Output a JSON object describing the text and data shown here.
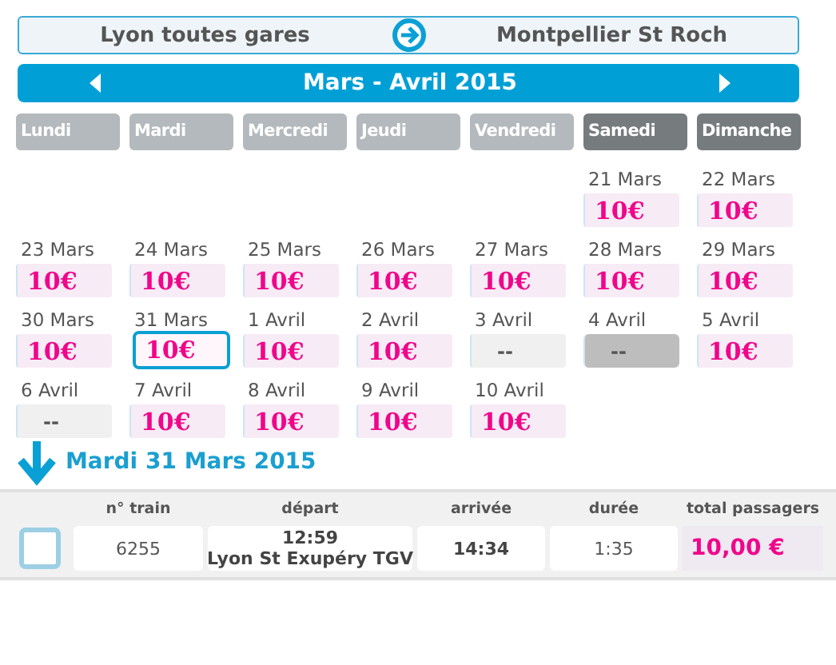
{
  "route": {
    "from": "Lyon toutes gares",
    "to": "Montpellier St Roch"
  },
  "month": {
    "title": "Mars - Avril 2015"
  },
  "weekdays": [
    {
      "label": "Lundi",
      "weekend": false
    },
    {
      "label": "Mardi",
      "weekend": false
    },
    {
      "label": "Mercredi",
      "weekend": false
    },
    {
      "label": "Jeudi",
      "weekend": false
    },
    {
      "label": "Vendredi",
      "weekend": false
    },
    {
      "label": "Samedi",
      "weekend": true
    },
    {
      "label": "Dimanche",
      "weekend": true
    }
  ],
  "weeks": [
    [
      {
        "kind": "empty"
      },
      {
        "kind": "empty"
      },
      {
        "kind": "empty"
      },
      {
        "kind": "empty"
      },
      {
        "kind": "empty"
      },
      {
        "kind": "price",
        "date": "21 Mars",
        "value": "10€",
        "selected": false,
        "hovered": false
      },
      {
        "kind": "price",
        "date": "22 Mars",
        "value": "10€",
        "selected": false,
        "hovered": false
      }
    ],
    [
      {
        "kind": "price",
        "date": "23 Mars",
        "value": "10€",
        "selected": false,
        "hovered": false
      },
      {
        "kind": "price",
        "date": "24 Mars",
        "value": "10€",
        "selected": false,
        "hovered": false
      },
      {
        "kind": "price",
        "date": "25 Mars",
        "value": "10€",
        "selected": false,
        "hovered": false
      },
      {
        "kind": "price",
        "date": "26 Mars",
        "value": "10€",
        "selected": false,
        "hovered": false
      },
      {
        "kind": "price",
        "date": "27 Mars",
        "value": "10€",
        "selected": false,
        "hovered": false
      },
      {
        "kind": "price",
        "date": "28 Mars",
        "value": "10€",
        "selected": false,
        "hovered": false
      },
      {
        "kind": "price",
        "date": "29 Mars",
        "value": "10€",
        "selected": false,
        "hovered": false
      }
    ],
    [
      {
        "kind": "price",
        "date": "30 Mars",
        "value": "10€",
        "selected": false,
        "hovered": false
      },
      {
        "kind": "price",
        "date": "31 Mars",
        "value": "10€",
        "selected": true,
        "hovered": false
      },
      {
        "kind": "price",
        "date": "1 Avril",
        "value": "10€",
        "selected": false,
        "hovered": false
      },
      {
        "kind": "price",
        "date": "2 Avril",
        "value": "10€",
        "selected": false,
        "hovered": false
      },
      {
        "kind": "unavailable",
        "date": "3 Avril",
        "value": "--",
        "selected": false,
        "hovered": false
      },
      {
        "kind": "unavailable",
        "date": "4 Avril",
        "value": "--",
        "selected": false,
        "hovered": true
      },
      {
        "kind": "price",
        "date": "5 Avril",
        "value": "10€",
        "selected": false,
        "hovered": false
      }
    ],
    [
      {
        "kind": "unavailable",
        "date": "6 Avril",
        "value": "--",
        "selected": false,
        "hovered": false
      },
      {
        "kind": "price",
        "date": "7 Avril",
        "value": "10€",
        "selected": false,
        "hovered": false
      },
      {
        "kind": "price",
        "date": "8 Avril",
        "value": "10€",
        "selected": false,
        "hovered": false
      },
      {
        "kind": "price",
        "date": "9 Avril",
        "value": "10€",
        "selected": false,
        "hovered": false
      },
      {
        "kind": "price",
        "date": "10 Avril",
        "value": "10€",
        "selected": false,
        "hovered": false
      },
      {
        "kind": "empty"
      },
      {
        "kind": "empty"
      }
    ]
  ],
  "selected_day": {
    "title": "Mardi 31 Mars 2015"
  },
  "trips": {
    "columns": [
      "n° train",
      "départ",
      "arrivée",
      "durée",
      "total passagers"
    ],
    "rows": [
      {
        "checked": false,
        "train": "6255",
        "departure_time": "12:59",
        "departure_station": "Lyon St Exupéry TGV",
        "arrival": "14:34",
        "duration": "1:35",
        "total": "10,00 €"
      }
    ]
  }
}
